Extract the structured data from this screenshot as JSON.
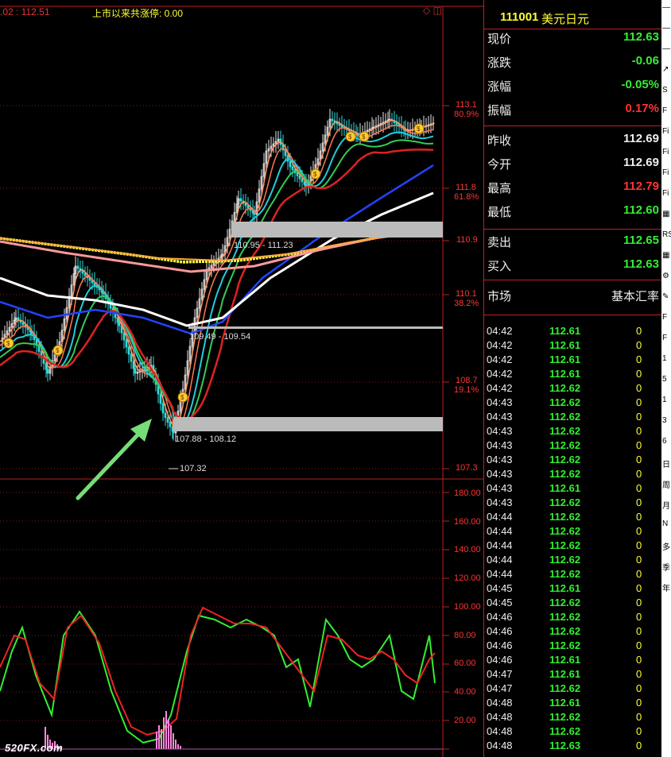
{
  "top_bar": {
    "price_fragment": ".02 : 112.51",
    "limit_text": "上市以来共涨停: 0.00",
    "icons": "◇ ◫"
  },
  "price_axis": [
    {
      "value": "113.1",
      "pct": "80.9%"
    },
    {
      "value": "111.8",
      "pct": "61.8%"
    },
    {
      "value": "110.9",
      "pct": ""
    },
    {
      "value": "110.1",
      "pct": "38.2%"
    },
    {
      "value": "108.7",
      "pct": "19.1%"
    },
    {
      "value": "107.3",
      "pct": ""
    }
  ],
  "level_labels": {
    "upper_band": "110.95 - 111.23",
    "mid_band": "109.49 - 109.54",
    "lower_band": "107.88 - 108.12",
    "low_mark": "107.32"
  },
  "indicator_axis": [
    "180.00",
    "160.00",
    "140.00",
    "120.00",
    "100.00",
    "80.00",
    "60.00",
    "40.00",
    "20.00"
  ],
  "watermark": "520FX.com",
  "colors": {
    "up": "#ff3333",
    "down": "#33ee33",
    "neutral": "#eeeeee",
    "accent_yellow": "#ffff33",
    "border": "#bb2222",
    "arrow": "#77dd77",
    "histogram": "#ff88dd"
  },
  "quote": {
    "code": "111001",
    "name": "美元日元",
    "rows": [
      {
        "label": "现价",
        "value": "112.63",
        "color": "#33ee33"
      },
      {
        "label": "涨跌",
        "value": "-0.06",
        "color": "#33ee33"
      },
      {
        "label": "涨幅",
        "value": "-0.05%",
        "color": "#33ee33"
      },
      {
        "label": "振幅",
        "value": "0.17%",
        "color": "#ff3333"
      },
      {
        "label": "昨收",
        "value": "112.69",
        "color": "#eeeeee"
      },
      {
        "label": "今开",
        "value": "112.69",
        "color": "#eeeeee"
      },
      {
        "label": "最高",
        "value": "112.79",
        "color": "#ff3333"
      },
      {
        "label": "最低",
        "value": "112.60",
        "color": "#33ee33"
      },
      {
        "label": "卖出",
        "value": "112.65",
        "color": "#33ee33"
      },
      {
        "label": "买入",
        "value": "112.63",
        "color": "#33ee33"
      }
    ],
    "market_label": "市场",
    "market_value": "基本汇率"
  },
  "ticks": [
    {
      "time": "04:42",
      "price": "112.61",
      "vol": "0"
    },
    {
      "time": "04:42",
      "price": "112.61",
      "vol": "0"
    },
    {
      "time": "04:42",
      "price": "112.61",
      "vol": "0"
    },
    {
      "time": "04:42",
      "price": "112.61",
      "vol": "0"
    },
    {
      "time": "04:42",
      "price": "112.62",
      "vol": "0"
    },
    {
      "time": "04:43",
      "price": "112.62",
      "vol": "0"
    },
    {
      "time": "04:43",
      "price": "112.62",
      "vol": "0"
    },
    {
      "time": "04:43",
      "price": "112.62",
      "vol": "0"
    },
    {
      "time": "04:43",
      "price": "112.62",
      "vol": "0"
    },
    {
      "time": "04:43",
      "price": "112.62",
      "vol": "0"
    },
    {
      "time": "04:43",
      "price": "112.62",
      "vol": "0"
    },
    {
      "time": "04:43",
      "price": "112.61",
      "vol": "0"
    },
    {
      "time": "04:43",
      "price": "112.62",
      "vol": "0"
    },
    {
      "time": "04:44",
      "price": "112.62",
      "vol": "0"
    },
    {
      "time": "04:44",
      "price": "112.62",
      "vol": "0"
    },
    {
      "time": "04:44",
      "price": "112.62",
      "vol": "0"
    },
    {
      "time": "04:44",
      "price": "112.62",
      "vol": "0"
    },
    {
      "time": "04:44",
      "price": "112.62",
      "vol": "0"
    },
    {
      "time": "04:45",
      "price": "112.61",
      "vol": "0"
    },
    {
      "time": "04:45",
      "price": "112.62",
      "vol": "0"
    },
    {
      "time": "04:46",
      "price": "112.62",
      "vol": "0"
    },
    {
      "time": "04:46",
      "price": "112.62",
      "vol": "0"
    },
    {
      "time": "04:46",
      "price": "112.62",
      "vol": "0"
    },
    {
      "time": "04:46",
      "price": "112.61",
      "vol": "0"
    },
    {
      "time": "04:47",
      "price": "112.61",
      "vol": "0"
    },
    {
      "time": "04:47",
      "price": "112.62",
      "vol": "0"
    },
    {
      "time": "04:48",
      "price": "112.61",
      "vol": "0"
    },
    {
      "time": "04:48",
      "price": "112.62",
      "vol": "0"
    },
    {
      "time": "04:48",
      "price": "112.62",
      "vol": "0"
    },
    {
      "time": "04:48",
      "price": "112.63",
      "vol": "0"
    }
  ],
  "side_strip": [
    "—",
    "—",
    "—",
    "↗",
    "S",
    "F",
    "Fi",
    "Fi",
    "Fi",
    "Fi",
    "▦",
    "RS",
    "▦",
    "⚙",
    "✎",
    "F",
    "F",
    "1",
    "5",
    "1",
    "3",
    "6",
    "日",
    "周",
    "月",
    "N",
    "多",
    "季",
    "年"
  ]
}
